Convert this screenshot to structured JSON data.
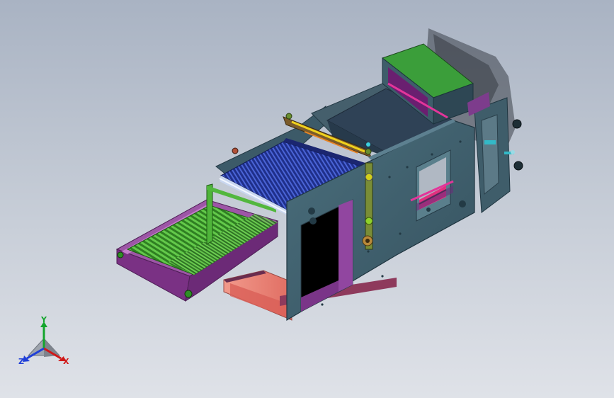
{
  "viewport": {
    "background_top": "#a9b3c3",
    "background_bottom": "#dfe2e8"
  },
  "colors": {
    "frame_teal": "#3d5d6b",
    "frame_edge": "#2b4350",
    "belt_purple": "#8a3f92",
    "conveyor_green": "#3c9a2a",
    "roller_blue": "#2a3fa6",
    "cover_green": "#37a140",
    "rail_magenta": "#e0308a",
    "underside_salmon": "#ef8a7c",
    "x_axis": "#d01818",
    "y_axis": "#13a52c",
    "z_axis": "#1f3fd8"
  },
  "triad": {
    "x_label": "X",
    "y_label": "Y",
    "z_label": "Z"
  }
}
